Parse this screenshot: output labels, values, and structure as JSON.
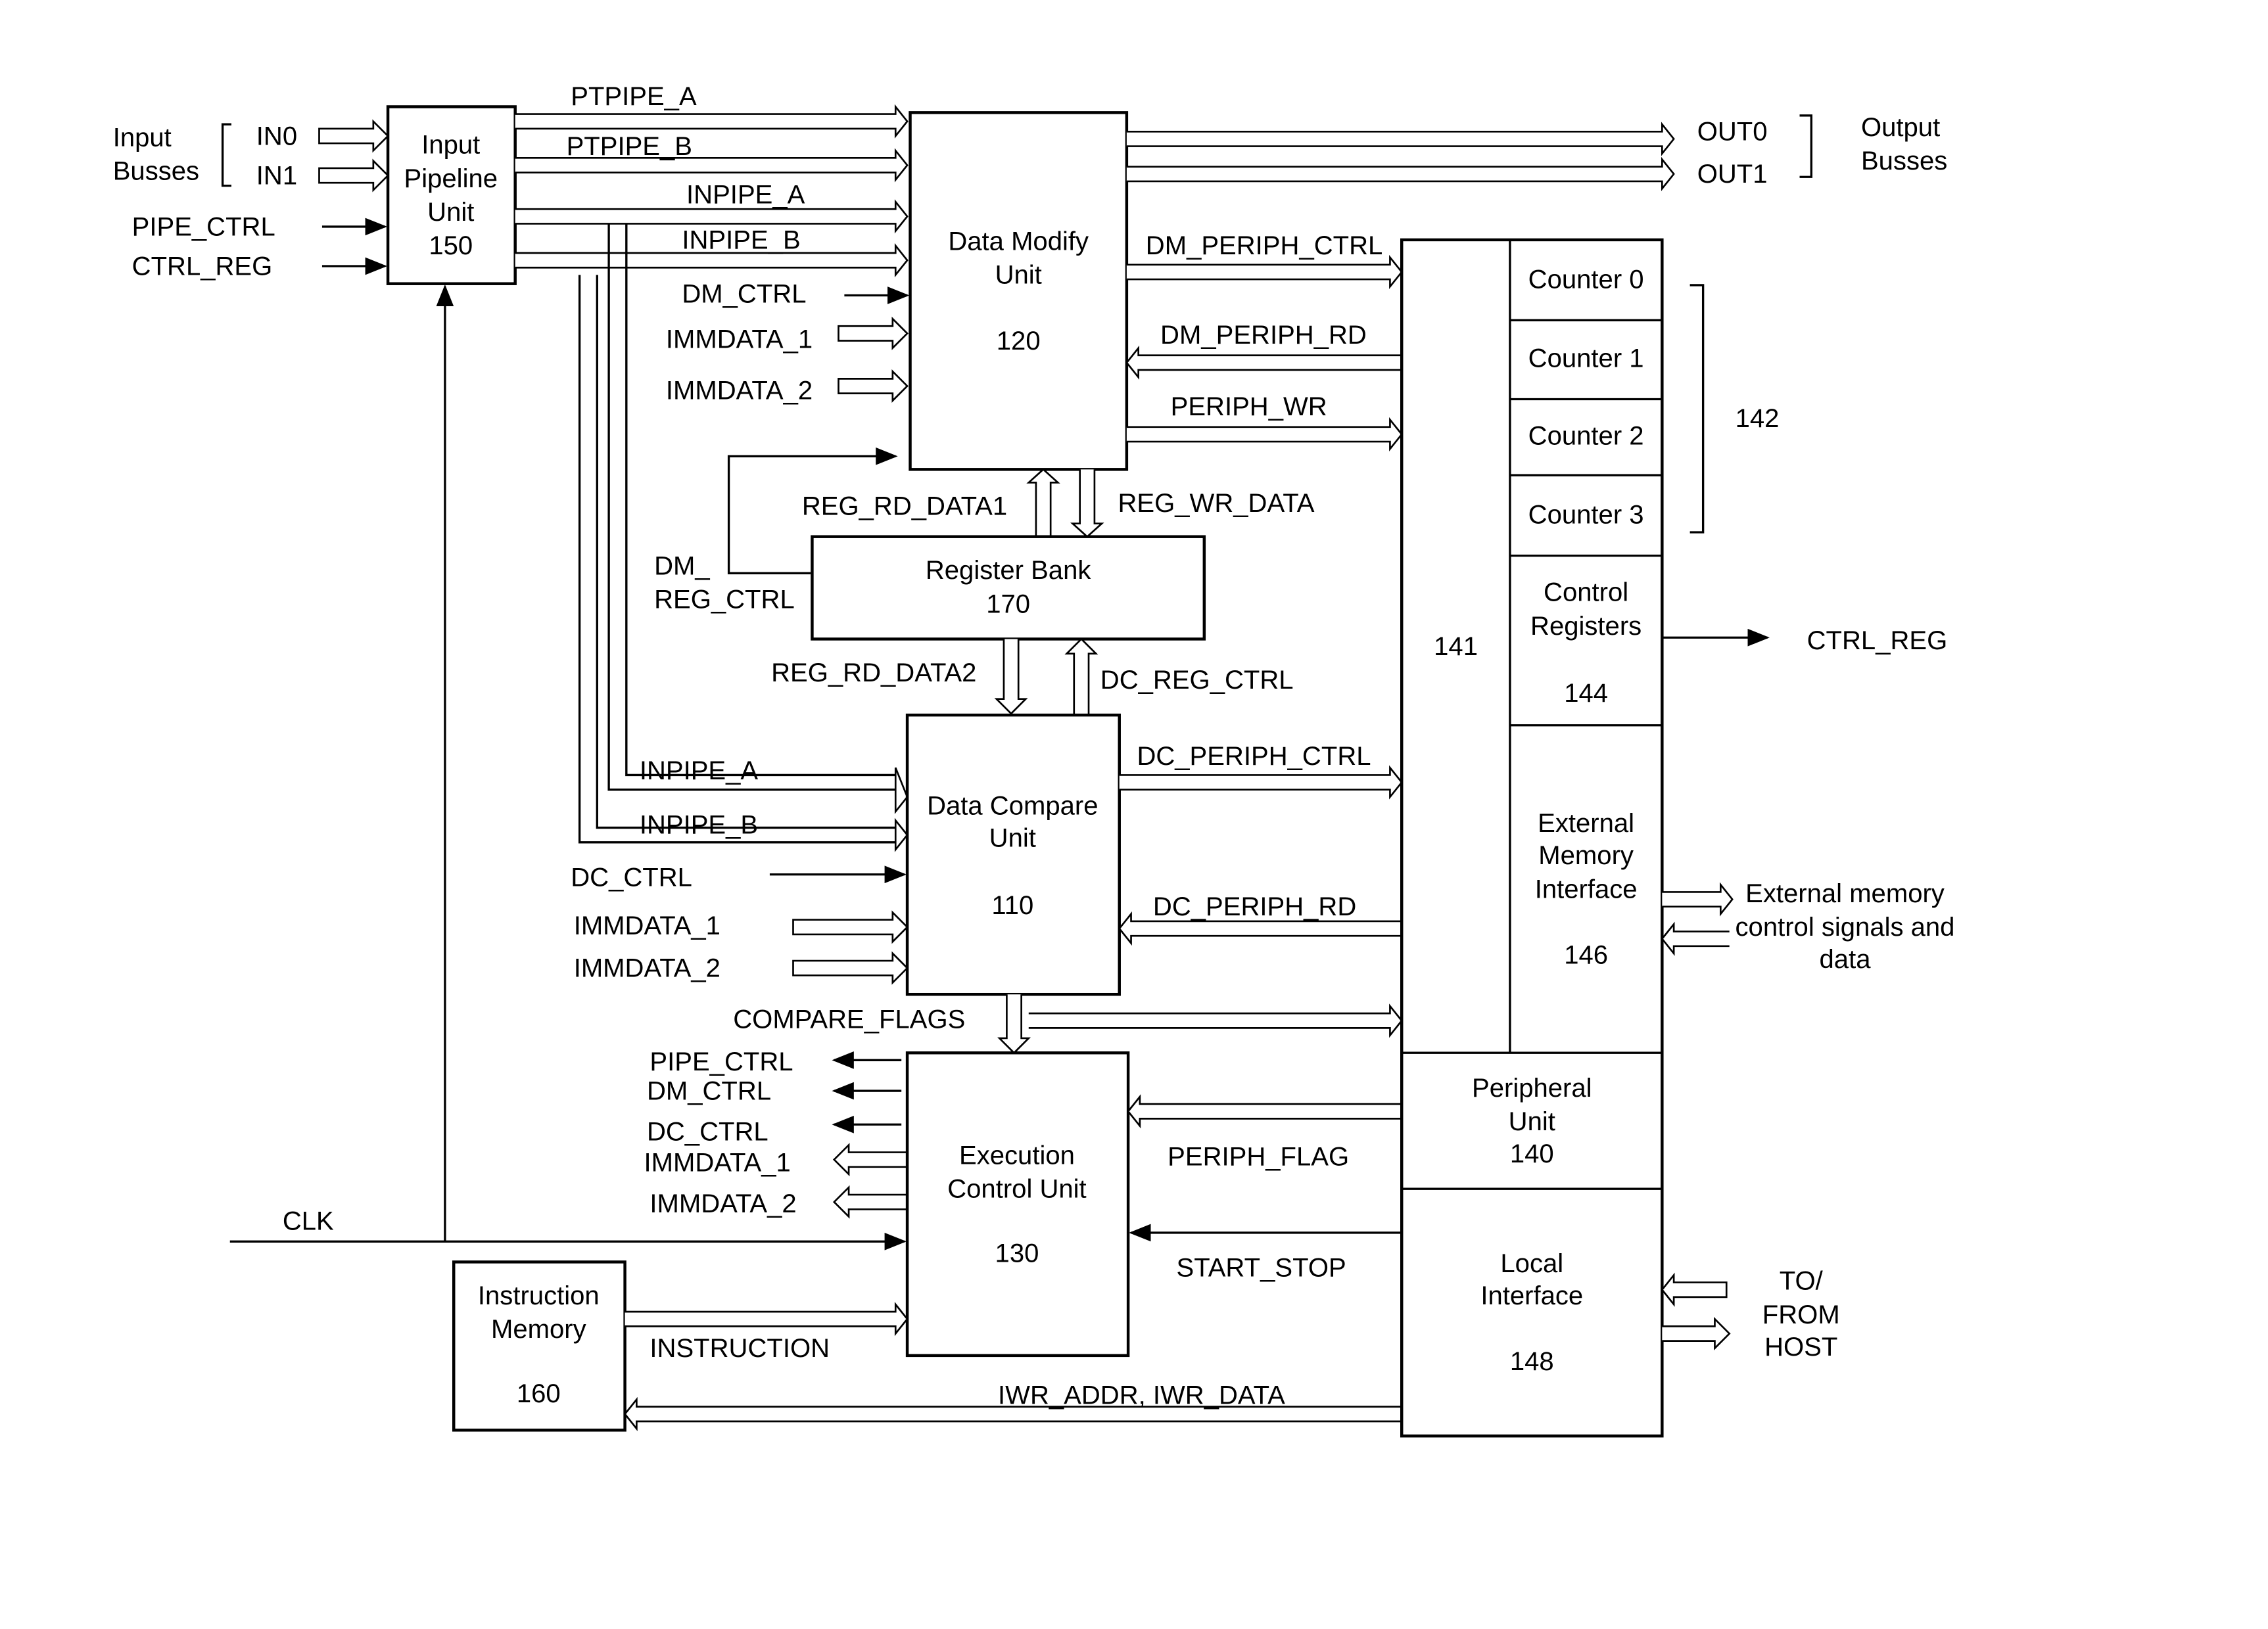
{
  "blocks": {
    "input_pipeline": [
      "Input",
      "Pipeline",
      "Unit",
      "150"
    ],
    "data_modify": [
      "Data Modify",
      "Unit",
      "120"
    ],
    "register_bank": [
      "Register Bank",
      "170"
    ],
    "data_compare": [
      "Data Compare",
      "Unit",
      "110"
    ],
    "execution_control": [
      "Execution",
      "Control Unit",
      "130"
    ],
    "instruction_memory": [
      "Instruction",
      "Memory",
      "160"
    ],
    "peripheral_bus": "141",
    "counters": [
      "Counter 0",
      "Counter 1",
      "Counter 2",
      "Counter 3"
    ],
    "counters_ref": "142",
    "control_registers": [
      "Control",
      "Registers",
      "144"
    ],
    "ext_mem_if": [
      "External",
      "Memory",
      "Interface",
      "146"
    ],
    "peripheral_unit": [
      "Peripheral",
      "Unit",
      "140"
    ],
    "local_interface": [
      "Local",
      "Interface",
      "148"
    ]
  },
  "labels": {
    "input_busses": [
      "Input",
      "Busses"
    ],
    "in0": "IN0",
    "in1": "IN1",
    "pipe_ctrl": "PIPE_CTRL",
    "ctrl_reg": "CTRL_REG",
    "ptpipe_a": "PTPIPE_A",
    "ptpipe_b": "PTPIPE_B",
    "inpipe_a": "INPIPE_A",
    "inpipe_b": "INPIPE_B",
    "dm_ctrl": "DM_CTRL",
    "immdata_1": "IMMDATA_1",
    "immdata_2": "IMMDATA_2",
    "out0": "OUT0",
    "out1": "OUT1",
    "output_busses": [
      "Output",
      "Busses"
    ],
    "dm_periph_ctrl": "DM_PERIPH_CTRL",
    "dm_periph_rd": "DM_PERIPH_RD",
    "periph_wr": "PERIPH_WR",
    "reg_rd_data1": "REG_RD_DATA1",
    "reg_wr_data": "REG_WR_DATA",
    "dm_reg_ctrl": [
      "DM_",
      "REG_CTRL"
    ],
    "reg_rd_data2": "REG_RD_DATA2",
    "dc_reg_ctrl": "DC_REG_CTRL",
    "dc_periph_ctrl": "DC_PERIPH_CTRL",
    "dc_ctrl": "DC_CTRL",
    "dc_periph_rd": "DC_PERIPH_RD",
    "compare_flags": "COMPARE_FLAGS",
    "periph_flag": "PERIPH_FLAG",
    "start_stop": "START_STOP",
    "clk": "CLK",
    "instruction": "INSTRUCTION",
    "iwr": "IWR_ADDR, IWR_DATA",
    "ctrl_reg_out": "CTRL_REG",
    "ext_mem_signals": [
      "External memory",
      "control signals and",
      "data"
    ],
    "host": [
      "TO/",
      "FROM",
      "HOST"
    ]
  }
}
